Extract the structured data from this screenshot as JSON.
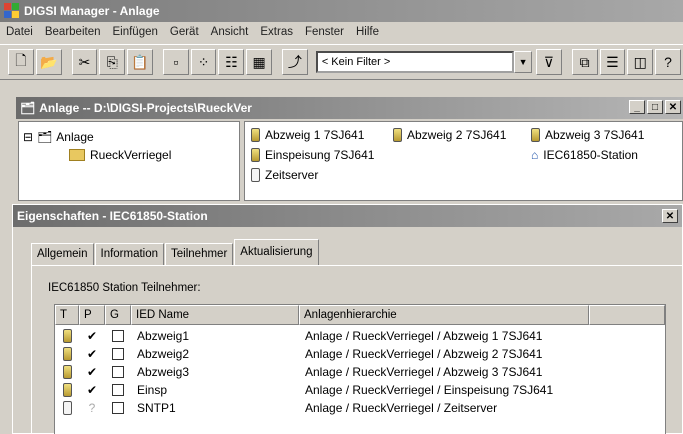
{
  "window": {
    "title": "DIGSI Manager - Anlage"
  },
  "menu": [
    "Datei",
    "Bearbeiten",
    "Einfügen",
    "Gerät",
    "Ansicht",
    "Extras",
    "Fenster",
    "Hilfe"
  ],
  "toolbar": {
    "filter_value": "< Kein Filter >",
    "icons": [
      "new-icon",
      "open-icon",
      "cut-icon",
      "copy-icon",
      "paste-icon",
      "large-icons-icon",
      "small-icons-icon",
      "list-view-icon",
      "details-view-icon",
      "up-level-icon",
      "filter-settings-icon",
      "cascade-icon",
      "tile-horizontal-icon",
      "tile-vertical-icon",
      "help-icon"
    ]
  },
  "project": {
    "title": "Anlage -- D:\\DIGSI-Projects\\RueckVer",
    "tree": [
      {
        "label": "Anlage",
        "toggle": "⊟"
      },
      {
        "label": "RueckVerriegel"
      }
    ],
    "items": [
      {
        "label": "Abzweig 1 7SJ641",
        "icon": "device-icon"
      },
      {
        "label": "Abzweig 2 7SJ641",
        "icon": "device-icon"
      },
      {
        "label": "Abzweig 3 7SJ641",
        "icon": "device-icon"
      },
      {
        "label": "Einspeisung 7SJ641",
        "icon": "device-icon"
      },
      {
        "label": "IEC61850-Station",
        "icon": "station-icon"
      },
      {
        "label": "Zeitserver",
        "icon": "device-empty-icon"
      }
    ]
  },
  "dialog": {
    "title": "Eigenschaften - IEC61850-Station",
    "tabs": [
      "Allgemein",
      "Information",
      "Teilnehmer",
      "Aktualisierung"
    ],
    "active_tab": "Aktualisierung",
    "group_label": "IEC61850 Station Teilnehmer:",
    "columns": [
      "T",
      "P",
      "G",
      "IED Name",
      "Anlagenhierarchie"
    ],
    "rows": [
      {
        "p": "✔",
        "g": "",
        "name": "Abzweig1",
        "path": "Anlage / RueckVerriegel / Abzweig 1 7SJ641"
      },
      {
        "p": "✔",
        "g": "",
        "name": "Abzweig2",
        "path": "Anlage / RueckVerriegel / Abzweig 2 7SJ641"
      },
      {
        "p": "✔",
        "g": "",
        "name": "Abzweig3",
        "path": "Anlage / RueckVerriegel / Abzweig 3 7SJ641"
      },
      {
        "p": "✔",
        "g": "",
        "name": "Einsp",
        "path": "Anlage / RueckVerriegel / Einspeisung 7SJ641"
      },
      {
        "p": "?",
        "g": "",
        "name": "SNTP1",
        "path": "Anlage / RueckVerriegel / Zeitserver"
      }
    ]
  }
}
